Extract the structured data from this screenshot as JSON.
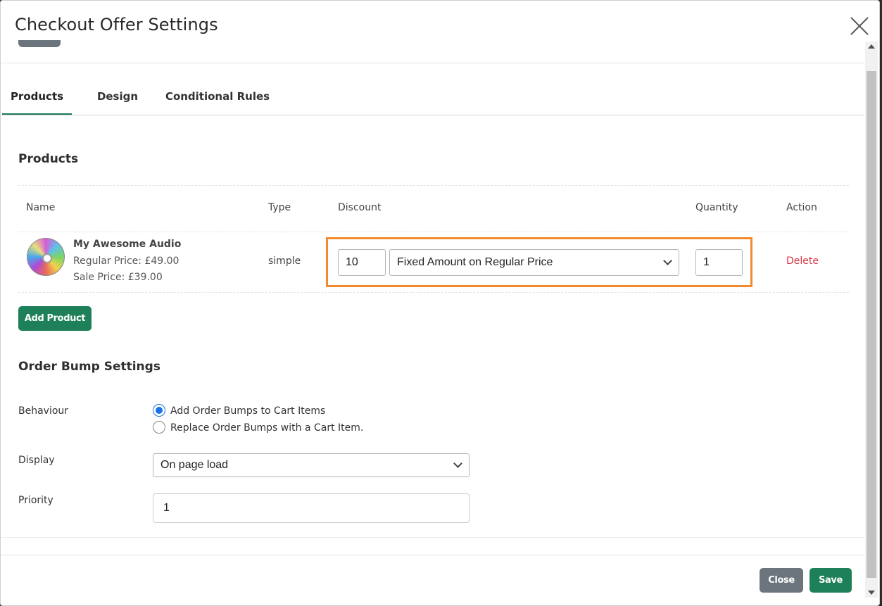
{
  "modal": {
    "title": "Checkout Offer Settings"
  },
  "tabs": [
    {
      "label": "Products",
      "active": true
    },
    {
      "label": "Design",
      "active": false
    },
    {
      "label": "Conditional Rules",
      "active": false
    }
  ],
  "products_section": {
    "title": "Products",
    "columns": [
      "Name",
      "Type",
      "Discount",
      "Quantity",
      "Action"
    ],
    "rows": [
      {
        "name": "My Awesome Audio",
        "regular_price": "Regular Price: £49.00",
        "sale_price": "Sale Price: £39.00",
        "type": "simple",
        "discount_value": "10",
        "discount_type": "Fixed Amount on Regular Price",
        "quantity": "1",
        "action": "Delete",
        "icon": "cd-icon"
      }
    ],
    "add_button": "Add Product"
  },
  "order_bump": {
    "title": "Order Bump Settings",
    "behaviour_label": "Behaviour",
    "behaviour_options": [
      {
        "label": "Add Order Bumps to Cart Items",
        "checked": true
      },
      {
        "label": "Replace Order Bumps with a Cart Item.",
        "checked": false
      }
    ],
    "display_label": "Display",
    "display_value": "On page load",
    "priority_label": "Priority",
    "priority_value": "1"
  },
  "footer": {
    "close_label": "Close",
    "save_label": "Save"
  },
  "colors": {
    "primary_green": "#1e8058",
    "secondary_gray": "#6c757d",
    "delete_red": "#dc3545",
    "highlight_orange": "#f28a30",
    "radio_blue": "#1a73e8"
  }
}
